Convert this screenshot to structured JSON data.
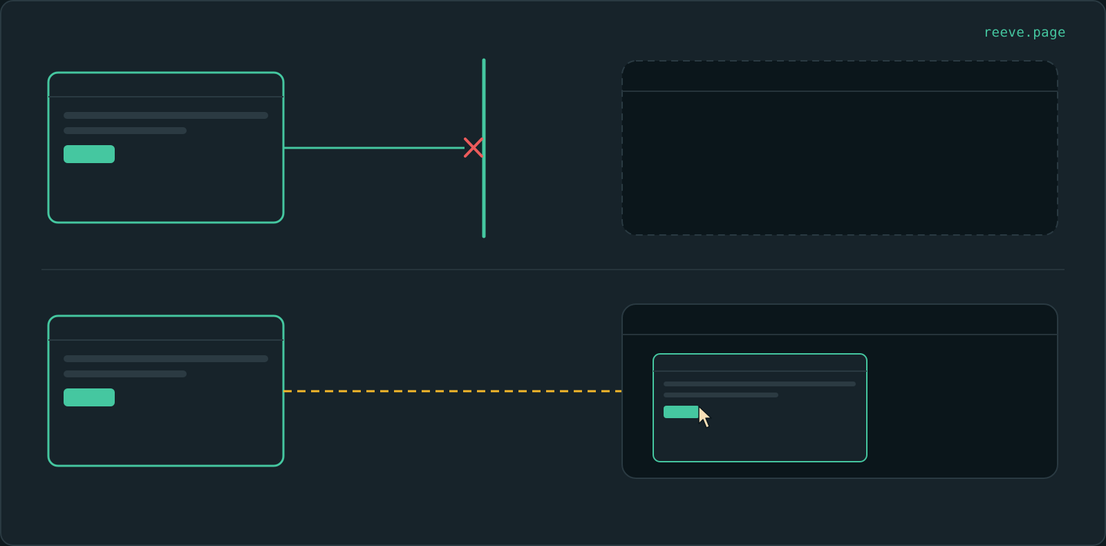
{
  "brand": {
    "text": "reeve.page"
  },
  "colors": {
    "background": "#17232a",
    "frame": "#2a3a42",
    "accent": "#45c7a0",
    "block": "#ec5b5b",
    "dashed_link": "#f5b82a",
    "skeleton": "#2b3a42",
    "inner_panel": "#0b161b",
    "cursor": "#f8dfb6"
  },
  "icons": {
    "block": "x-mark-icon",
    "pointer": "mouse-cursor-icon"
  }
}
